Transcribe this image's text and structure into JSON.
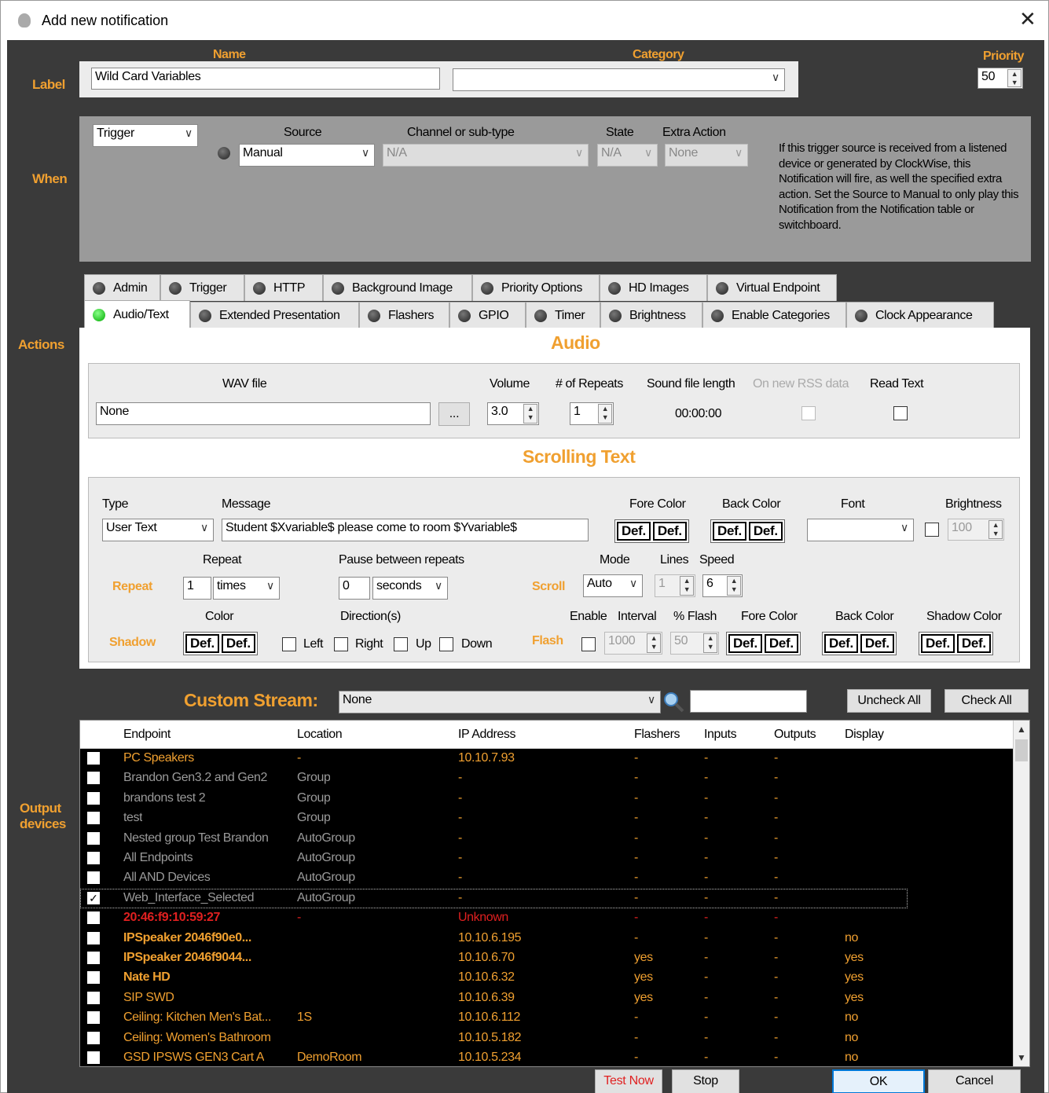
{
  "window": {
    "title": "Add new notification",
    "close_glyph": "✕"
  },
  "sections": {
    "label": "Label",
    "when": "When",
    "actions": "Actions",
    "output_l1": "Output",
    "output_l2": "devices"
  },
  "label_row": {
    "name_header": "Name",
    "name_value": "Wild Card Variables",
    "category_header": "Category",
    "category_value": "",
    "priority_header": "Priority",
    "priority_value": "50"
  },
  "when": {
    "trigger_value": "Trigger",
    "source_header": "Source",
    "source_value": "Manual",
    "channel_header": "Channel or sub-type",
    "channel_value": "N/A",
    "state_header": "State",
    "state_value": "N/A",
    "extra_header": "Extra Action",
    "extra_value": "None",
    "help_text": "If this trigger source is received from a listened device or generated by ClockWise, this Notification will fire, as well the specified extra action. Set the Source to Manual to only play this Notification from the Notification table or switchboard."
  },
  "tabs_row1": [
    "Admin",
    "Trigger",
    "HTTP",
    "Background Image",
    "Priority Options",
    "HD Images",
    "Virtual Endpoint"
  ],
  "tabs_row2": [
    "Audio/Text",
    "Extended Presentation",
    "Flashers",
    "GPIO",
    "Timer",
    "Brightness",
    "Enable Categories",
    "Clock Appearance"
  ],
  "audio": {
    "title": "Audio",
    "wav_header": "WAV file",
    "wav_value": "None",
    "browse": "...",
    "volume_header": "Volume",
    "volume_value": "3.0",
    "repeats_header": "# of Repeats",
    "repeats_value": "1",
    "length_header": "Sound file length",
    "length_value": "00:00:00",
    "rss_header": "On new RSS data",
    "read_header": "Read Text"
  },
  "scroll": {
    "title": "Scrolling Text",
    "type_header": "Type",
    "type_value": "User Text",
    "message_header": "Message",
    "message_value": "Student $Xvariable$ please come to room $Yvariable$",
    "fore_header": "Fore Color",
    "back_header": "Back Color",
    "font_header": "Font",
    "font_value": "",
    "bright_header": "Brightness",
    "bright_value": "100",
    "def": "Def.",
    "repeat_label": "Repeat",
    "repeat_header": "Repeat",
    "repeat_value": "1",
    "repeat_unit": "times",
    "pause_header": "Pause between repeats",
    "pause_value": "0",
    "pause_unit": "seconds",
    "scroll_label": "Scroll",
    "mode_header": "Mode",
    "mode_value": "Auto",
    "lines_header": "Lines",
    "lines_value": "1",
    "speed_header": "Speed",
    "speed_value": "6",
    "shadow_label": "Shadow",
    "color_header": "Color",
    "dir_header": "Direction(s)",
    "dir_left": "Left",
    "dir_right": "Right",
    "dir_up": "Up",
    "dir_down": "Down",
    "flash_label": "Flash",
    "enable_header": "Enable",
    "interval_header": "Interval",
    "interval_value": "1000",
    "pflash_header": "% Flash",
    "pflash_value": "50",
    "ffore_header": "Fore Color",
    "fback_header": "Back Color",
    "fshadow_header": "Shadow Color"
  },
  "stream": {
    "label": "Custom Stream:",
    "value": "None",
    "search_value": "",
    "uncheck": "Uncheck All",
    "check": "Check All"
  },
  "grid": {
    "headers": [
      "Endpoint",
      "Location",
      "IP Address",
      "Flashers",
      "Inputs",
      "Outputs",
      "Display"
    ],
    "rows": [
      {
        "checked": false,
        "endpoint": "PC Speakers",
        "location": "-",
        "ip": "10.10.7.93",
        "flashers": "-",
        "inputs": "-",
        "outputs": "-",
        "display": "",
        "style": "orange"
      },
      {
        "checked": false,
        "endpoint": "Brandon Gen3.2 and Gen2",
        "location": "Group",
        "ip": "-",
        "flashers": "-",
        "inputs": "-",
        "outputs": "-",
        "display": "",
        "style": "grey"
      },
      {
        "checked": false,
        "endpoint": "brandons test 2",
        "location": "Group",
        "ip": "-",
        "flashers": "-",
        "inputs": "-",
        "outputs": "-",
        "display": "",
        "style": "grey"
      },
      {
        "checked": false,
        "endpoint": "test",
        "location": "Group",
        "ip": "-",
        "flashers": "-",
        "inputs": "-",
        "outputs": "-",
        "display": "",
        "style": "grey"
      },
      {
        "checked": false,
        "endpoint": "Nested group Test Brandon",
        "location": "AutoGroup",
        "ip": "-",
        "flashers": "-",
        "inputs": "-",
        "outputs": "-",
        "display": "",
        "style": "grey"
      },
      {
        "checked": false,
        "endpoint": "All Endpoints",
        "location": "AutoGroup",
        "ip": "-",
        "flashers": "-",
        "inputs": "-",
        "outputs": "-",
        "display": "",
        "style": "grey"
      },
      {
        "checked": false,
        "endpoint": "All AND Devices",
        "location": "AutoGroup",
        "ip": "-",
        "flashers": "-",
        "inputs": "-",
        "outputs": "-",
        "display": "",
        "style": "grey"
      },
      {
        "checked": true,
        "endpoint": "Web_Interface_Selected",
        "location": "AutoGroup",
        "ip": "-",
        "flashers": "-",
        "inputs": "-",
        "outputs": "-",
        "display": "",
        "style": "grey"
      },
      {
        "checked": false,
        "endpoint": "20:46:f9:10:59:27",
        "location": "-",
        "ip": "Unknown",
        "flashers": "-",
        "inputs": "-",
        "outputs": "-",
        "display": "",
        "style": "red"
      },
      {
        "checked": false,
        "endpoint": "IPSpeaker 2046f90e0...",
        "location": "",
        "ip": "10.10.6.195",
        "flashers": "-",
        "inputs": "-",
        "outputs": "-",
        "display": "no",
        "style": "bold"
      },
      {
        "checked": false,
        "endpoint": "IPSpeaker 2046f9044...",
        "location": "",
        "ip": "10.10.6.70",
        "flashers": "yes",
        "inputs": "-",
        "outputs": "-",
        "display": "yes",
        "style": "bold"
      },
      {
        "checked": false,
        "endpoint": "Nate HD",
        "location": "",
        "ip": "10.10.6.32",
        "flashers": "yes",
        "inputs": "-",
        "outputs": "-",
        "display": "yes",
        "style": "bold"
      },
      {
        "checked": false,
        "endpoint": "SIP SWD",
        "location": "",
        "ip": "10.10.6.39",
        "flashers": "yes",
        "inputs": "-",
        "outputs": "-",
        "display": "yes",
        "style": "orange"
      },
      {
        "checked": false,
        "endpoint": "Ceiling: Kitchen Men's Bat...",
        "location": "1S",
        "ip": "10.10.6.112",
        "flashers": "-",
        "inputs": "-",
        "outputs": "-",
        "display": "no",
        "style": "orange"
      },
      {
        "checked": false,
        "endpoint": "Ceiling: Women's Bathroom",
        "location": "",
        "ip": "10.10.5.182",
        "flashers": "-",
        "inputs": "-",
        "outputs": "-",
        "display": "no",
        "style": "orange"
      },
      {
        "checked": false,
        "endpoint": "GSD IPSWS GEN3 Cart A",
        "location": "DemoRoom",
        "ip": "10.10.5.234",
        "flashers": "-",
        "inputs": "-",
        "outputs": "-",
        "display": "no",
        "style": "orange"
      }
    ]
  },
  "footer": {
    "test": "Test Now",
    "stop": "Stop",
    "ok": "OK",
    "cancel": "Cancel"
  },
  "colors": {
    "accent": "#f0a030",
    "background": "#3a3a3a",
    "warning": "#e02020",
    "led_on": "#00c000"
  }
}
